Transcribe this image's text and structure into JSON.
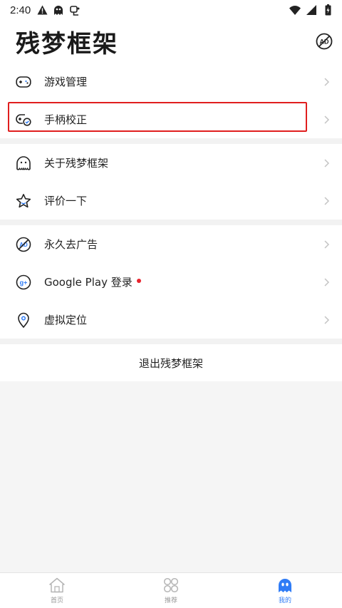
{
  "status_bar": {
    "time": "2:40",
    "icons": [
      "warning-icon",
      "ghost-icon",
      "gamepad-icon"
    ],
    "right_icons": [
      "wifi-icon",
      "signal-icon",
      "battery-icon"
    ]
  },
  "header": {
    "title": "残梦框架",
    "ad_icon": "no-ad-icon"
  },
  "menu_groups": [
    [
      {
        "label": "游戏管理",
        "icon": "gamepad-icon"
      },
      {
        "label": "手柄校正",
        "icon": "gamepad-calibrate-icon"
      }
    ],
    [
      {
        "label": "关于残梦框架",
        "icon": "ghost-icon"
      },
      {
        "label": "评价一下",
        "icon": "star-icon"
      }
    ],
    [
      {
        "label": "永久去广告",
        "icon": "no-ad-icon"
      },
      {
        "label": "Google Play 登录",
        "icon": "google-plus-icon",
        "badge": "red-dot"
      },
      {
        "label": "虚拟定位",
        "icon": "location-pin-icon"
      }
    ]
  ],
  "logout_label": "退出残梦框架",
  "tabs": [
    {
      "label": "首页",
      "icon": "home-icon",
      "active": false
    },
    {
      "label": "推荐",
      "icon": "grid-icon",
      "active": false
    },
    {
      "label": "我的",
      "icon": "ghost-icon",
      "active": true
    }
  ],
  "colors": {
    "accent": "#2f7cf6",
    "highlight_border": "#e01e1e",
    "badge": "#e8242e",
    "background": "#f5f5f5"
  }
}
